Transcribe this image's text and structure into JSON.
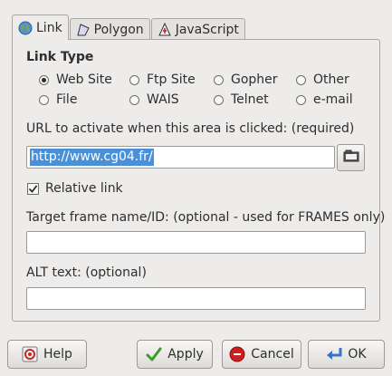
{
  "tabs": [
    {
      "label": "Link",
      "icon": "globe-icon",
      "active": true
    },
    {
      "label": "Polygon",
      "icon": "polygon-icon",
      "active": false
    },
    {
      "label": "JavaScript",
      "icon": "javascript-icon",
      "active": false
    }
  ],
  "link_type": {
    "heading": "Link Type",
    "options": [
      {
        "label": "Web Site",
        "checked": true
      },
      {
        "label": "Ftp Site",
        "checked": false
      },
      {
        "label": "Gopher",
        "checked": false
      },
      {
        "label": "Other",
        "checked": false
      },
      {
        "label": "File",
        "checked": false
      },
      {
        "label": "WAIS",
        "checked": false
      },
      {
        "label": "Telnet",
        "checked": false
      },
      {
        "label": "e-mail",
        "checked": false
      }
    ]
  },
  "url": {
    "label": "URL to activate when this area is clicked: (required)",
    "value": "http://www.cg04.fr/"
  },
  "relative_link": {
    "label": "Relative link",
    "checked": true
  },
  "target": {
    "label": "Target frame name/ID: (optional - used for FRAMES only)",
    "value": ""
  },
  "alt": {
    "label": "ALT text: (optional)",
    "value": ""
  },
  "buttons": {
    "help": "Help",
    "apply": "Apply",
    "cancel": "Cancel",
    "ok": "OK"
  },
  "colors": {
    "selection": "#4a90d9",
    "apply_check": "#3c9a2e",
    "cancel_stop": "#cc1f1f",
    "ok_arrow": "#3a74c4"
  }
}
